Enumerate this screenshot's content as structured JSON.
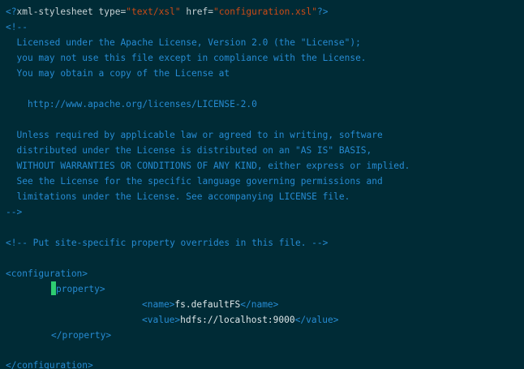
{
  "window": {
    "title": ""
  },
  "colors": {
    "background": "#002b36",
    "tag": "#268bd2",
    "string": "#cb4b16",
    "comment": "#268bd2",
    "text": "#dde6e8",
    "cursor": "#2ecc71"
  },
  "editor": {
    "pi": {
      "open": "<?",
      "target": "xml-stylesheet",
      "attr1_name": "type=",
      "attr1_value": "\"text/xsl\"",
      "attr2_name": "href=",
      "attr2_value": "\"configuration.xsl\"",
      "close": "?>"
    },
    "license_comment": {
      "open": "<!--",
      "lines": [
        "  Licensed under the Apache License, Version 2.0 (the \"License\");",
        "  you may not use this file except in compliance with the License.",
        "  You may obtain a copy of the License at",
        "",
        "    http://www.apache.org/licenses/LICENSE-2.0",
        "",
        "  Unless required by applicable law or agreed to in writing, software",
        "  distributed under the License is distributed on an \"AS IS\" BASIS,",
        "  WITHOUT WARRANTIES OR CONDITIONS OF ANY KIND, either express or implied.",
        "  See the License for the specific language governing permissions and",
        "  limitations under the License. See accompanying LICENSE file."
      ],
      "close": "-->"
    },
    "site_comment": "<!-- Put site-specific property overrides in this file. -->",
    "config_open": "<configuration>",
    "property_open_rest": "property>",
    "name_open": "<name>",
    "name_value": "fs.defaultFS",
    "name_close": "</name>",
    "value_open": "<value>",
    "value_value": "hdfs://localhost:9000",
    "value_close": "</value>",
    "property_close": "</property>",
    "config_close": "</configuration>"
  }
}
